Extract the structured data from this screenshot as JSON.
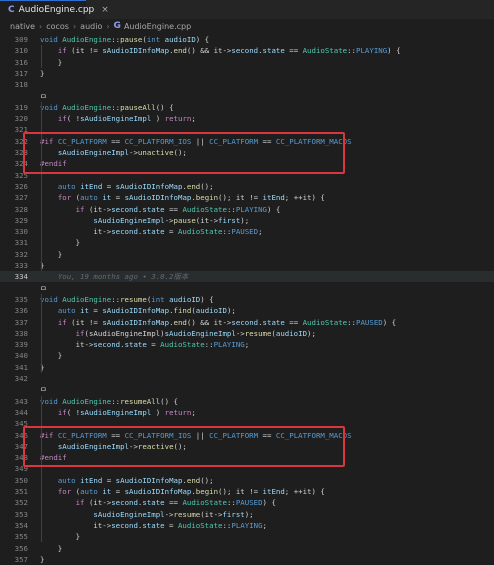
{
  "tab": {
    "icon": "C",
    "title": "AudioEngine.cpp",
    "close": "×"
  },
  "breadcrumb": [
    "native",
    "cocos",
    "audio",
    "AudioEngine.cpp"
  ],
  "breadcrumb_file_icon": "G",
  "blame": "You, 19 months ago • 3.0.2版本",
  "code_lines": [
    {
      "ln": "309",
      "segs": [
        [
          "k",
          "void "
        ],
        [
          "t",
          "AudioEngine"
        ],
        [
          "p",
          "::"
        ],
        [
          "f",
          "pause"
        ],
        [
          "p",
          "("
        ],
        [
          "k",
          "int "
        ],
        [
          "v",
          "audioID"
        ],
        [
          "p",
          ") {"
        ]
      ]
    },
    {
      "ln": "310",
      "segs": [
        [
          "p",
          "    "
        ],
        [
          "ctl",
          "if "
        ],
        [
          "p",
          "(it != "
        ],
        [
          "v",
          "sAudioIDInfoMap"
        ],
        [
          "p",
          "."
        ],
        [
          "f",
          "end"
        ],
        [
          "p",
          "() && it->"
        ],
        [
          "v",
          "second"
        ],
        [
          "p",
          "."
        ],
        [
          "v",
          "state"
        ],
        [
          "p",
          " == "
        ],
        [
          "t",
          "AudioState"
        ],
        [
          "p",
          "::"
        ],
        [
          "m",
          "PLAYING"
        ],
        [
          "p",
          ") {"
        ]
      ]
    },
    {
      "ln": "316",
      "segs": [
        [
          "p",
          "    }"
        ]
      ]
    },
    {
      "ln": "317",
      "segs": [
        [
          "p",
          "}"
        ]
      ]
    },
    {
      "ln": "318",
      "segs": [
        [
          "p",
          ""
        ]
      ]
    },
    {
      "ln": "",
      "segs": [
        [
          "p",
          "ㅁ"
        ]
      ]
    },
    {
      "ln": "319",
      "segs": [
        [
          "k",
          "void "
        ],
        [
          "t",
          "AudioEngine"
        ],
        [
          "p",
          "::"
        ],
        [
          "f",
          "pauseAll"
        ],
        [
          "p",
          "() {"
        ]
      ]
    },
    {
      "ln": "320",
      "segs": [
        [
          "p",
          "    "
        ],
        [
          "ctl",
          "if"
        ],
        [
          "p",
          "( !"
        ],
        [
          "v",
          "sAudioEngineImpl"
        ],
        [
          "p",
          " ) "
        ],
        [
          "ctl",
          "return"
        ],
        [
          "p",
          ";"
        ]
      ]
    },
    {
      "ln": "321",
      "segs": [
        [
          "p",
          ""
        ]
      ]
    },
    {
      "ln": "322",
      "segs": [
        [
          "pp",
          "#if "
        ],
        [
          "m",
          "CC_PLATFORM"
        ],
        [
          "p",
          " == "
        ],
        [
          "m",
          "CC_PLATFORM_IOS"
        ],
        [
          "p",
          " || "
        ],
        [
          "m",
          "CC_PLATFORM"
        ],
        [
          "p",
          " == "
        ],
        [
          "m",
          "CC_PLATFORM_MACOS"
        ]
      ]
    },
    {
      "ln": "323",
      "segs": [
        [
          "p",
          "    "
        ],
        [
          "v",
          "sAudioEngineImpl"
        ],
        [
          "p",
          "->"
        ],
        [
          "f",
          "unactive"
        ],
        [
          "p",
          "();"
        ]
      ]
    },
    {
      "ln": "324",
      "segs": [
        [
          "pp",
          "#endif"
        ]
      ]
    },
    {
      "ln": "325",
      "segs": [
        [
          "p",
          ""
        ]
      ]
    },
    {
      "ln": "326",
      "segs": [
        [
          "p",
          "    "
        ],
        [
          "k",
          "auto "
        ],
        [
          "v",
          "itEnd"
        ],
        [
          "p",
          " = "
        ],
        [
          "v",
          "sAudioIDInfoMap"
        ],
        [
          "p",
          "."
        ],
        [
          "f",
          "end"
        ],
        [
          "p",
          "();"
        ]
      ]
    },
    {
      "ln": "327",
      "segs": [
        [
          "p",
          "    "
        ],
        [
          "ctl",
          "for "
        ],
        [
          "p",
          "("
        ],
        [
          "k",
          "auto "
        ],
        [
          "v",
          "it"
        ],
        [
          "p",
          " = "
        ],
        [
          "v",
          "sAudioIDInfoMap"
        ],
        [
          "p",
          "."
        ],
        [
          "f",
          "begin"
        ],
        [
          "p",
          "(); it != "
        ],
        [
          "v",
          "itEnd"
        ],
        [
          "p",
          "; ++it) {"
        ]
      ]
    },
    {
      "ln": "328",
      "segs": [
        [
          "p",
          "        "
        ],
        [
          "ctl",
          "if "
        ],
        [
          "p",
          "(it->"
        ],
        [
          "v",
          "second"
        ],
        [
          "p",
          "."
        ],
        [
          "v",
          "state"
        ],
        [
          "p",
          " == "
        ],
        [
          "t",
          "AudioState"
        ],
        [
          "p",
          "::"
        ],
        [
          "m",
          "PLAYING"
        ],
        [
          "p",
          ") {"
        ]
      ]
    },
    {
      "ln": "329",
      "segs": [
        [
          "p",
          "            "
        ],
        [
          "v",
          "sAudioEngineImpl"
        ],
        [
          "p",
          "->"
        ],
        [
          "f",
          "pause"
        ],
        [
          "p",
          "(it->"
        ],
        [
          "v",
          "first"
        ],
        [
          "p",
          ");"
        ]
      ]
    },
    {
      "ln": "330",
      "segs": [
        [
          "p",
          "            it->"
        ],
        [
          "v",
          "second"
        ],
        [
          "p",
          "."
        ],
        [
          "v",
          "state"
        ],
        [
          "p",
          " = "
        ],
        [
          "t",
          "AudioState"
        ],
        [
          "p",
          "::"
        ],
        [
          "m",
          "PAUSED"
        ],
        [
          "p",
          ";"
        ]
      ]
    },
    {
      "ln": "331",
      "segs": [
        [
          "p",
          "        }"
        ]
      ]
    },
    {
      "ln": "332",
      "segs": [
        [
          "p",
          "    }"
        ]
      ]
    },
    {
      "ln": "333",
      "segs": [
        [
          "p",
          "}"
        ]
      ]
    },
    {
      "ln": "334",
      "segs": [
        [
          "p",
          "    "
        ],
        [
          "blame",
          "You, 19 months ago • 3.0.2版本"
        ]
      ]
    },
    {
      "ln": "",
      "segs": [
        [
          "p",
          "ㅁ"
        ]
      ]
    },
    {
      "ln": "335",
      "segs": [
        [
          "k",
          "void "
        ],
        [
          "t",
          "AudioEngine"
        ],
        [
          "p",
          "::"
        ],
        [
          "f",
          "resume"
        ],
        [
          "p",
          "("
        ],
        [
          "k",
          "int "
        ],
        [
          "v",
          "audioID"
        ],
        [
          "p",
          ") {"
        ]
      ]
    },
    {
      "ln": "336",
      "segs": [
        [
          "p",
          "    "
        ],
        [
          "k",
          "auto "
        ],
        [
          "v",
          "it"
        ],
        [
          "p",
          " = "
        ],
        [
          "v",
          "sAudioIDInfoMap"
        ],
        [
          "p",
          "."
        ],
        [
          "f",
          "find"
        ],
        [
          "p",
          "("
        ],
        [
          "v",
          "audioID"
        ],
        [
          "p",
          ");"
        ]
      ]
    },
    {
      "ln": "337",
      "segs": [
        [
          "p",
          "    "
        ],
        [
          "ctl",
          "if "
        ],
        [
          "p",
          "(it != "
        ],
        [
          "v",
          "sAudioIDInfoMap"
        ],
        [
          "p",
          "."
        ],
        [
          "f",
          "end"
        ],
        [
          "p",
          "() && it->"
        ],
        [
          "v",
          "second"
        ],
        [
          "p",
          "."
        ],
        [
          "v",
          "state"
        ],
        [
          "p",
          " == "
        ],
        [
          "t",
          "AudioState"
        ],
        [
          "p",
          "::"
        ],
        [
          "m",
          "PAUSED"
        ],
        [
          "p",
          ") {"
        ]
      ]
    },
    {
      "ln": "338",
      "segs": [
        [
          "p",
          "        "
        ],
        [
          "ctl",
          "if"
        ],
        [
          "p",
          "(sAudioEngineImpl)"
        ],
        [
          "v",
          "sAudioEngineImpl"
        ],
        [
          "p",
          "->"
        ],
        [
          "f",
          "resume"
        ],
        [
          "p",
          "("
        ],
        [
          "v",
          "audioID"
        ],
        [
          "p",
          ");"
        ]
      ]
    },
    {
      "ln": "339",
      "segs": [
        [
          "p",
          "        it->"
        ],
        [
          "v",
          "second"
        ],
        [
          "p",
          "."
        ],
        [
          "v",
          "state"
        ],
        [
          "p",
          " = "
        ],
        [
          "t",
          "AudioState"
        ],
        [
          "p",
          "::"
        ],
        [
          "m",
          "PLAYING"
        ],
        [
          "p",
          ";"
        ]
      ]
    },
    {
      "ln": "340",
      "segs": [
        [
          "p",
          "    }"
        ]
      ]
    },
    {
      "ln": "341",
      "segs": [
        [
          "p",
          "}"
        ]
      ]
    },
    {
      "ln": "342",
      "segs": [
        [
          "p",
          ""
        ]
      ]
    },
    {
      "ln": "",
      "segs": [
        [
          "p",
          "ㅁ"
        ]
      ]
    },
    {
      "ln": "343",
      "segs": [
        [
          "k",
          "void "
        ],
        [
          "t",
          "AudioEngine"
        ],
        [
          "p",
          "::"
        ],
        [
          "f",
          "resumeAll"
        ],
        [
          "p",
          "() {"
        ]
      ]
    },
    {
      "ln": "344",
      "segs": [
        [
          "p",
          "    "
        ],
        [
          "ctl",
          "if"
        ],
        [
          "p",
          "( !"
        ],
        [
          "v",
          "sAudioEngineImpl"
        ],
        [
          "p",
          " ) "
        ],
        [
          "ctl",
          "return"
        ],
        [
          "p",
          ";"
        ]
      ]
    },
    {
      "ln": "345",
      "segs": [
        [
          "p",
          ""
        ]
      ]
    },
    {
      "ln": "346",
      "segs": [
        [
          "pp",
          "#if "
        ],
        [
          "m",
          "CC_PLATFORM"
        ],
        [
          "p",
          " == "
        ],
        [
          "m",
          "CC_PLATFORM_IOS"
        ],
        [
          "p",
          " || "
        ],
        [
          "m",
          "CC_PLATFORM"
        ],
        [
          "p",
          " == "
        ],
        [
          "m",
          "CC_PLATFORM_MACOS"
        ]
      ]
    },
    {
      "ln": "347",
      "segs": [
        [
          "p",
          "    "
        ],
        [
          "v",
          "sAudioEngineImpl"
        ],
        [
          "p",
          "->"
        ],
        [
          "f",
          "reactive"
        ],
        [
          "p",
          "();"
        ]
      ]
    },
    {
      "ln": "348",
      "segs": [
        [
          "pp",
          "#endif"
        ]
      ]
    },
    {
      "ln": "349",
      "segs": [
        [
          "p",
          ""
        ]
      ]
    },
    {
      "ln": "350",
      "segs": [
        [
          "p",
          "    "
        ],
        [
          "k",
          "auto "
        ],
        [
          "v",
          "itEnd"
        ],
        [
          "p",
          " = "
        ],
        [
          "v",
          "sAudioIDInfoMap"
        ],
        [
          "p",
          "."
        ],
        [
          "f",
          "end"
        ],
        [
          "p",
          "();"
        ]
      ]
    },
    {
      "ln": "351",
      "segs": [
        [
          "p",
          "    "
        ],
        [
          "ctl",
          "for "
        ],
        [
          "p",
          "("
        ],
        [
          "k",
          "auto "
        ],
        [
          "v",
          "it"
        ],
        [
          "p",
          " = "
        ],
        [
          "v",
          "sAudioIDInfoMap"
        ],
        [
          "p",
          "."
        ],
        [
          "f",
          "begin"
        ],
        [
          "p",
          "(); it != "
        ],
        [
          "v",
          "itEnd"
        ],
        [
          "p",
          "; ++it) {"
        ]
      ]
    },
    {
      "ln": "352",
      "segs": [
        [
          "p",
          "        "
        ],
        [
          "ctl",
          "if "
        ],
        [
          "p",
          "(it->"
        ],
        [
          "v",
          "second"
        ],
        [
          "p",
          "."
        ],
        [
          "v",
          "state"
        ],
        [
          "p",
          " == "
        ],
        [
          "t",
          "AudioState"
        ],
        [
          "p",
          "::"
        ],
        [
          "m",
          "PAUSED"
        ],
        [
          "p",
          ") {"
        ]
      ]
    },
    {
      "ln": "353",
      "segs": [
        [
          "p",
          "            "
        ],
        [
          "v",
          "sAudioEngineImpl"
        ],
        [
          "p",
          "->"
        ],
        [
          "f",
          "resume"
        ],
        [
          "p",
          "(it->"
        ],
        [
          "v",
          "first"
        ],
        [
          "p",
          ");"
        ]
      ]
    },
    {
      "ln": "354",
      "segs": [
        [
          "p",
          "            it->"
        ],
        [
          "v",
          "second"
        ],
        [
          "p",
          "."
        ],
        [
          "v",
          "state"
        ],
        [
          "p",
          " = "
        ],
        [
          "t",
          "AudioState"
        ],
        [
          "p",
          "::"
        ],
        [
          "m",
          "PLAYING"
        ],
        [
          "p",
          ";"
        ]
      ]
    },
    {
      "ln": "355",
      "segs": [
        [
          "p",
          "        }"
        ]
      ]
    },
    {
      "ln": "356",
      "segs": [
        [
          "p",
          "    }"
        ]
      ]
    },
    {
      "ln": "357",
      "segs": [
        [
          "p",
          "}"
        ]
      ]
    }
  ],
  "current_line": "334",
  "colors": {
    "highlight_box": "#d9363e",
    "background": "#1e1e1e",
    "tab_accent": "#2f6fd1"
  }
}
